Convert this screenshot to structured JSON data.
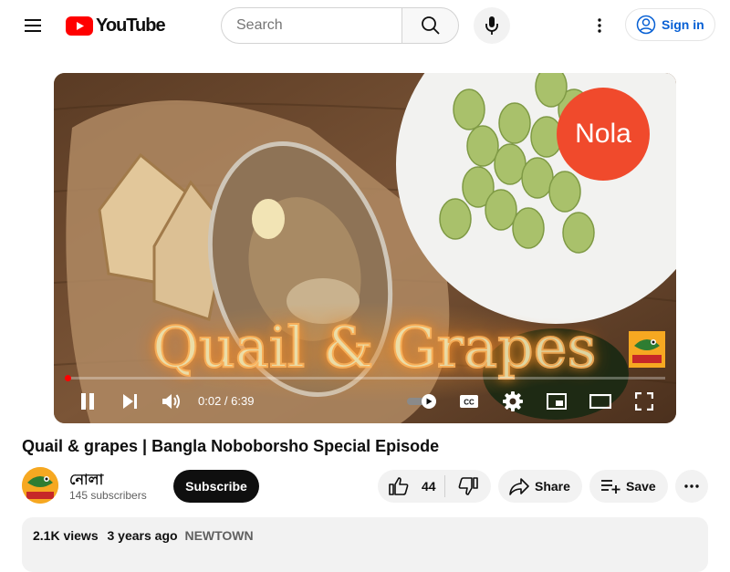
{
  "header": {
    "logo_text": "YouTube",
    "search_placeholder": "Search",
    "sign_in_label": "Sign in"
  },
  "player": {
    "overlay_title": "Quail & Grapes",
    "brand_badge": "Nola",
    "current_time": "0:02",
    "duration": "6:39",
    "time_display": "0:02 / 6:39",
    "progress_fraction": 0.005
  },
  "video": {
    "title": "Quail & grapes | Bangla Noboborsho Special Episode"
  },
  "channel": {
    "name": "নোলা",
    "subscribers": "145 subscribers",
    "subscribe_label": "Subscribe"
  },
  "actions": {
    "like_count": "44",
    "share_label": "Share",
    "save_label": "Save"
  },
  "description": {
    "views": "2.1K views",
    "age": "3 years ago",
    "location": "NEWTOWN"
  },
  "colors": {
    "brand_red": "#ff0000",
    "link_blue": "#065fd4",
    "pill_bg": "#f2f2f2"
  }
}
